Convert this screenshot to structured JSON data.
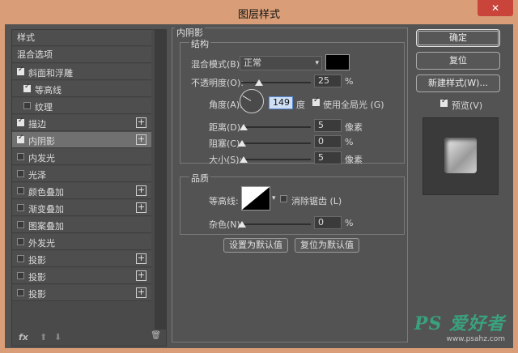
{
  "window": {
    "title": "图层样式",
    "close_label": "✕"
  },
  "left": {
    "header": "样式",
    "blend_options": "混合选项",
    "items": [
      {
        "label": "斜面和浮雕",
        "checked": true,
        "plus": false,
        "indent": false,
        "selected": false
      },
      {
        "label": "等高线",
        "checked": true,
        "plus": false,
        "indent": true,
        "selected": false
      },
      {
        "label": "纹理",
        "checked": false,
        "plus": false,
        "indent": true,
        "selected": false
      },
      {
        "label": "描边",
        "checked": true,
        "plus": true,
        "indent": false,
        "selected": false
      },
      {
        "label": "内阴影",
        "checked": true,
        "plus": true,
        "indent": false,
        "selected": true
      },
      {
        "label": "内发光",
        "checked": false,
        "plus": false,
        "indent": false,
        "selected": false
      },
      {
        "label": "光泽",
        "checked": false,
        "plus": false,
        "indent": false,
        "selected": false
      },
      {
        "label": "颜色叠加",
        "checked": false,
        "plus": true,
        "indent": false,
        "selected": false
      },
      {
        "label": "渐变叠加",
        "checked": false,
        "plus": true,
        "indent": false,
        "selected": false
      },
      {
        "label": "图案叠加",
        "checked": false,
        "plus": false,
        "indent": false,
        "selected": false
      },
      {
        "label": "外发光",
        "checked": false,
        "plus": false,
        "indent": false,
        "selected": false
      },
      {
        "label": "投影",
        "checked": false,
        "plus": true,
        "indent": false,
        "selected": false
      },
      {
        "label": "投影",
        "checked": false,
        "plus": true,
        "indent": false,
        "selected": false
      },
      {
        "label": "投影",
        "checked": false,
        "plus": true,
        "indent": false,
        "selected": false
      }
    ],
    "footer": {
      "fx": "fx",
      "up": "⬆",
      "down": "⬇",
      "trash": "🗑"
    }
  },
  "inner_shadow": {
    "title": "内阴影",
    "structure": {
      "title": "结构",
      "blend_mode_label": "混合模式(B):",
      "blend_mode_value": "正常",
      "swatch_color": "#000000",
      "opacity_label": "不透明度(O):",
      "opacity_value": "25",
      "opacity_unit": "%",
      "angle_label": "角度(A):",
      "angle_value": "149",
      "angle_unit": "度",
      "global_light_label": "使用全局光 (G)",
      "global_light_checked": true,
      "distance_label": "距离(D):",
      "distance_value": "5",
      "distance_unit": "像素",
      "choke_label": "阻塞(C):",
      "choke_value": "0",
      "choke_unit": "%",
      "size_label": "大小(S):",
      "size_value": "5",
      "size_unit": "像素"
    },
    "quality": {
      "title": "品质",
      "contour_label": "等高线:",
      "antialias_label": "消除锯齿 (L)",
      "antialias_checked": false,
      "noise_label": "杂色(N):",
      "noise_value": "0",
      "noise_unit": "%"
    },
    "make_default": "设置为默认值",
    "reset_default": "复位为默认值"
  },
  "right": {
    "ok": "确定",
    "reset": "复位",
    "new_style": "新建样式(W)...",
    "preview_label": "预览(V)",
    "preview_checked": true
  },
  "watermark": {
    "logo": "PS 爱好者",
    "url": "www.psahz.com"
  }
}
